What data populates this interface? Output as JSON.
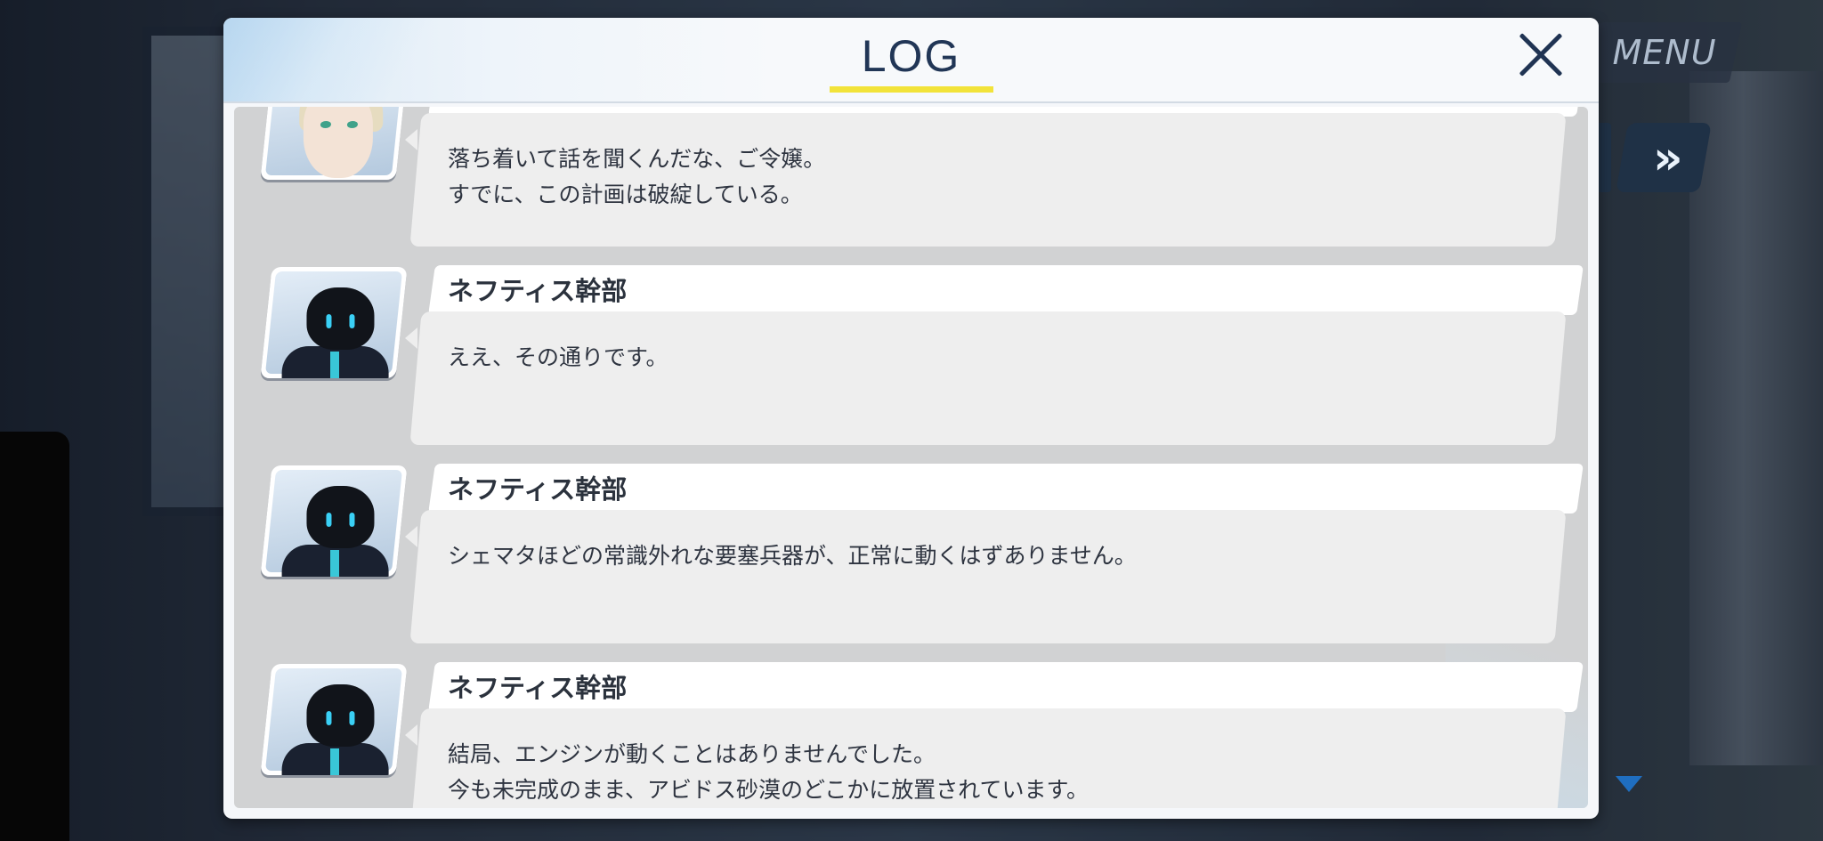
{
  "hud": {
    "menu_label": "MENU",
    "fast_forward_glyph": "»"
  },
  "log": {
    "title": "LOG",
    "entries": [
      {
        "speaker": "",
        "avatar": "girl-avatar",
        "lines": [
          "落ち着いて話を聞くんだな、ご令嬢。",
          "すでに、この計画は破綻している。"
        ]
      },
      {
        "speaker": "ネフティス幹部",
        "avatar": "robot-avatar",
        "lines": [
          "ええ、その通りです。"
        ]
      },
      {
        "speaker": "ネフティス幹部",
        "avatar": "robot-avatar",
        "lines": [
          "シェマタほどの常識外れな要塞兵器が、正常に動くはずありません。"
        ]
      },
      {
        "speaker": "ネフティス幹部",
        "avatar": "robot-avatar",
        "lines": [
          "結局、エンジンが動くことはありませんでした。",
          "今も未完成のまま、アビドス砂漠のどこかに放置されています。"
        ]
      }
    ]
  },
  "colors": {
    "title": "#213656",
    "underline": "#f2e33a",
    "bubble": "#eeeeee",
    "name_tab": "#ffffff"
  }
}
